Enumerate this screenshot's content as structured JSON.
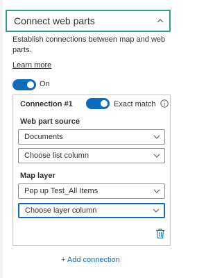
{
  "section": {
    "title": "Connect web parts",
    "description": "Establish connections between map and web parts.",
    "learn_more": "Learn more",
    "main_toggle": {
      "label": "On",
      "state": "on"
    }
  },
  "connection": {
    "title": "Connection #1",
    "exact_match": {
      "label": "Exact match",
      "state": "on"
    },
    "web_part_source": {
      "label": "Web part source",
      "source_value": "Documents",
      "column_placeholder": "Choose list column"
    },
    "map_layer": {
      "label": "Map layer",
      "layer_value": "Pop up Test_All Items",
      "column_placeholder": "Choose layer column"
    }
  },
  "add_connection": "+ Add connection",
  "icons": {
    "collapse": "chevron-up-icon",
    "dropdown": "chevron-down-icon",
    "info": "info-icon",
    "delete": "trash-icon"
  },
  "colors": {
    "accent": "#0f6cbd",
    "header_border": "#2da58b",
    "text": "#323130",
    "border": "#8a8886"
  }
}
